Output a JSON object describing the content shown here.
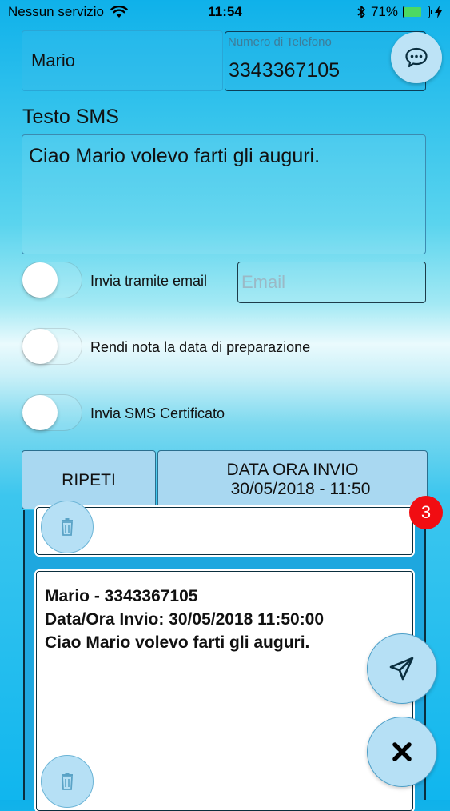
{
  "status_bar": {
    "carrier": "Nessun servizio",
    "time": "11:54",
    "battery_percent": "71%",
    "battery_level": 0.71
  },
  "form": {
    "name_value": "Mario",
    "phone_placeholder": "Numero di Telefono",
    "phone_value": "3343367105",
    "sms_label": "Testo SMS",
    "sms_text": "Ciao Mario volevo farti gli auguri.",
    "email_toggle_label": "Invia tramite email",
    "email_placeholder": "Email",
    "prep_date_toggle_label": "Rendi nota la data di preparazione",
    "certified_toggle_label": "Invia SMS Certificato"
  },
  "buttons": {
    "repeat_label": "RIPETI",
    "datetime_label": "DATA ORA INVIO",
    "datetime_value": "30/05/2018 - 11:50"
  },
  "queue": {
    "badge_count": "3",
    "messages": [
      {
        "line1": "Mario - 3343367105",
        "line2": "Data/Ora Invio: 30/05/2018 11:50:00",
        "line3": "Ciao Mario volevo farti gli auguri."
      }
    ]
  },
  "icons": {
    "chat": "chat-bubble-icon",
    "trash": "trash-icon",
    "send": "paper-plane-icon",
    "close": "close-x-icon",
    "wifi": "wifi-icon",
    "bluetooth": "bluetooth-icon",
    "charging": "charging-bolt-icon"
  },
  "colors": {
    "accent_blue": "#1ea7df",
    "button_fill": "#a9d8f1",
    "badge_red": "#f10d12",
    "battery_green": "#4cd964"
  }
}
